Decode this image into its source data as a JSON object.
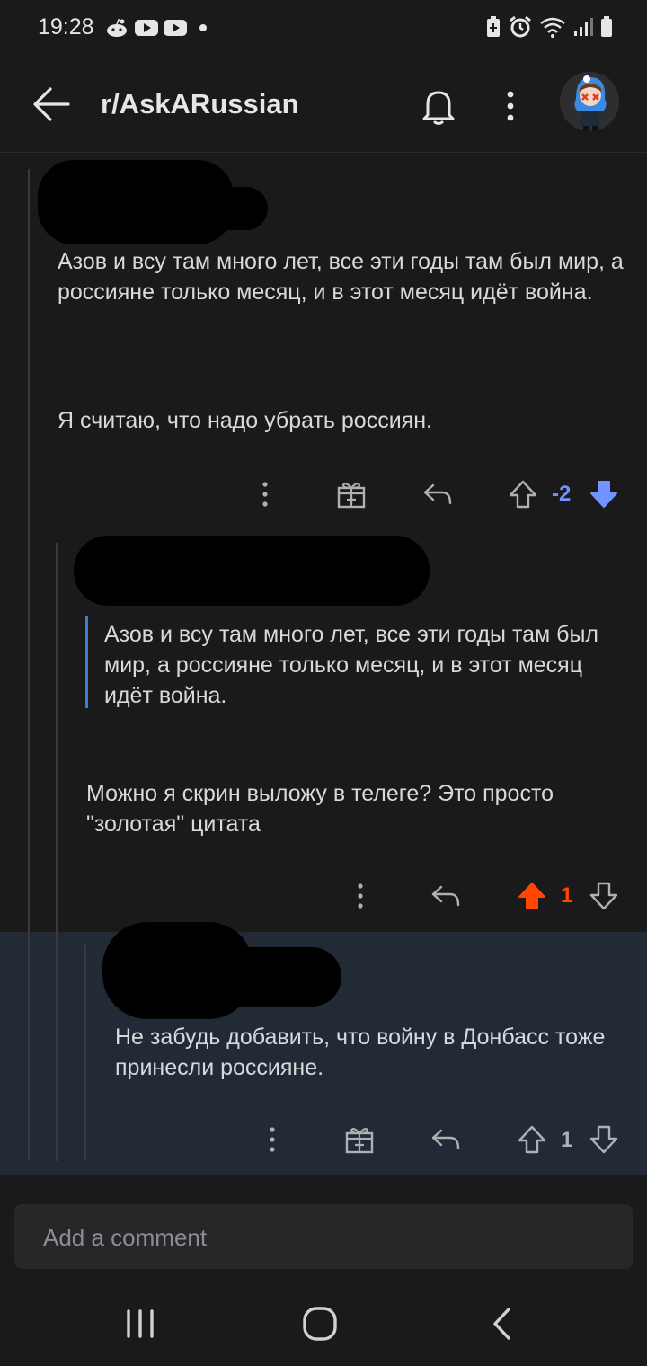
{
  "status_bar": {
    "time": "19:28",
    "left_icons": [
      "reddit-icon",
      "youtube-icon",
      "youtube-icon",
      "notification-dot"
    ],
    "right_icons": [
      "battery-saver-icon",
      "alarm-icon",
      "wifi-icon",
      "signal-icon",
      "battery-icon"
    ]
  },
  "header": {
    "subreddit": "r/AskARussian",
    "icons": [
      "back-arrow-icon",
      "bell-icon",
      "more-vertical-icon",
      "user-avatar"
    ]
  },
  "comments": [
    {
      "author_redacted": true,
      "paragraphs": [
        "Азов и всу там много лет, все эти годы там был мир, а россияне только месяц, и в этот месяц идёт война.",
        "Я считаю, что надо убрать россиян."
      ],
      "score": "-2",
      "vote_state": "downvoted",
      "actions": [
        "more-icon",
        "award-icon",
        "reply-icon",
        "upvote-icon",
        "downvote-icon"
      ]
    },
    {
      "author_redacted": true,
      "quote": "Азов и всу там много лет, все эти годы там был мир, а россияне только месяц, и в этот месяц идёт война.",
      "paragraphs": [
        "Можно я скрин выложу в телеге? Это просто \"золотая\" цитата"
      ],
      "score": "1",
      "vote_state": "upvoted",
      "actions": [
        "more-icon",
        "reply-icon",
        "upvote-icon",
        "downvote-icon"
      ]
    },
    {
      "author_redacted": true,
      "highlighted": true,
      "paragraphs": [
        "Не забудь добавить, что войну в Донбасс тоже принесли россияне."
      ],
      "score": "1",
      "vote_state": "none",
      "actions": [
        "more-icon",
        "award-icon",
        "reply-icon",
        "upvote-icon",
        "downvote-icon"
      ]
    }
  ],
  "composer": {
    "placeholder": "Add a comment"
  },
  "colors": {
    "background": "#1a1a1b",
    "highlight": "#222a35",
    "downvote": "#7193ff",
    "upvote": "#ff4500",
    "quote_bar": "#3d7bd6"
  }
}
